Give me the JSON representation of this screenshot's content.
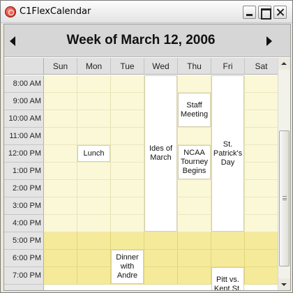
{
  "window": {
    "title": "C1FlexCalendar",
    "app_icon": "app-logo-icon",
    "buttons": [
      "minimize-icon",
      "maximize-icon",
      "close-icon"
    ]
  },
  "calendar": {
    "header_title": "Week of March 12, 2006",
    "prev_icon": "chevron-left-icon",
    "next_icon": "chevron-right-icon",
    "days": [
      "Sun",
      "Mon",
      "Tue",
      "Wed",
      "Thu",
      "Fri",
      "Sat"
    ],
    "times": [
      "8:00 AM",
      "9:00 AM",
      "10:00 AM",
      "11:00 AM",
      "12:00 PM",
      "1:00 PM",
      "2:00 PM",
      "3:00 PM",
      "4:00 PM",
      "5:00 PM",
      "6:00 PM",
      "7:00 PM"
    ],
    "evening_start_hour": "5:00 PM",
    "appointments": [
      {
        "text": "Ides of March",
        "day": "Wed",
        "start": "8:00 AM",
        "end": "5:00 PM"
      },
      {
        "text": "Staff Meeting",
        "day": "Thu",
        "start": "9:00 AM",
        "end": "11:00 AM"
      },
      {
        "text": "NCAA Tourney Begins",
        "day": "Thu",
        "start": "12:00 PM",
        "end": "2:00 PM"
      },
      {
        "text": "St. Patrick's Day",
        "day": "Fri",
        "start": "8:00 AM",
        "end": "5:00 PM"
      },
      {
        "text": "Lunch",
        "day": "Mon",
        "start": "12:00 PM",
        "end": "1:00 PM"
      },
      {
        "text": "Dinner with Andre",
        "day": "Tue",
        "start": "6:00 PM",
        "end": "8:00 PM"
      },
      {
        "text": "Pitt vs. Kent St.",
        "day": "Fri",
        "start": "7:00 PM",
        "end": "8:00 PM"
      }
    ],
    "colors": {
      "workday": "#fbf8d8",
      "evening": "#f4ea9a",
      "appointment": "#ffffff"
    }
  }
}
